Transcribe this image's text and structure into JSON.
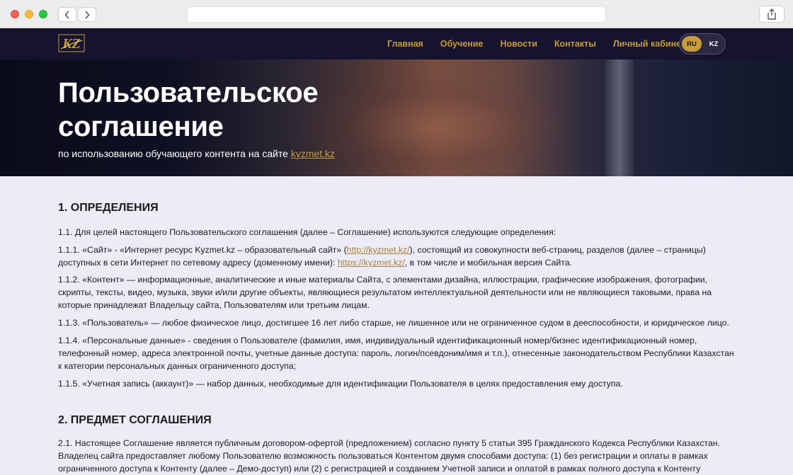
{
  "browser": {
    "back_icon": "chevron-left-icon",
    "forward_icon": "chevron-right-icon",
    "share_icon": "share-icon",
    "address": ""
  },
  "nav": {
    "logo_text": "KZ",
    "items": [
      "Главная",
      "Обучение",
      "Новости",
      "Контакты",
      "Личный кабинет"
    ],
    "lang_active": "RU",
    "lang_other": "KZ"
  },
  "hero": {
    "title": "Пользовательское соглашение",
    "subtitle_prefix": "по использованию обучающего контента на сайте ",
    "subtitle_link": "kyzmet.kz"
  },
  "sections": [
    {
      "heading": "1. ОПРЕДЕЛЕНИЯ",
      "p1": "1.1. Для целей настоящего Пользовательского соглашения (далее – Соглашение) используются следующие определения:",
      "p2_a": "1.1.1. «Сайт» - «Интернет ресурс Kyzmet.kz – образовательный сайт» (",
      "p2_link1": "http://kyzmet.kz/",
      "p2_b": "), состоящий из совокупности веб-страниц, разделов (далее – страницы) доступных в сети Интернет по сетевому адресу (доменному имени): ",
      "p2_link2": "https://kyzmet.kz/",
      "p2_c": ", в том числе и мобильная версия Сайта.",
      "p3": "1.1.2. «Контент» — информационные, аналитические и иные материалы Сайта, с элементами дизайна, иллюстрации, графические изображения, фотографии, скрипты, тексты, видео, музыка, звуки и/или другие объекты, являющиеся результатом интеллектуальной деятельности или не являющиеся таковыми, права на которые принадлежат Владельцу сайта, Пользователям или третьим лицам.",
      "p4": "1.1.3. «Пользователь» — любое физическое лицо, достигшее 16 лет либо старше, не лишенное или не ограниченное судом в дееспособности, и юридическое лицо.",
      "p5": "1.1.4. «Персональные данные» - сведения о Пользователе (фамилия, имя, индивидуальный идентификационный номер/бизнес идентификационный номер, телефонный номер, адреса электронной почты, учетные данные доступа: пароль, логин/псевдоним/имя и т.п.), отнесенные законодательством Республики Казахстан к категории персональных данных ограниченного доступа;",
      "p6": "1.1.5. «Учетная запись (аккаунт)» — набор данных, необходимые для идентификации Пользователя в целях предоставления ему доступа."
    },
    {
      "heading": "2. ПРЕДМЕТ СОГЛАШЕНИЯ",
      "p1": "2.1. Настоящее Соглашение является публичным договором-офертой (предложением) согласно пункту 5 статьи 395 Гражданского Кодекса Республики Казахстан. Владелец сайта предоставляет любому Пользователю возможность пользоваться Контентом двумя способами доступа: (1) без регистрации и оплаты в рамках ограниченного доступа к Контенту (далее – Демо-доступ) или (2) с регистрацией и созданием Учетной записи и оплатой в рамках полного доступа к Контенту"
    }
  ],
  "colors": {
    "accent": "#c89b3c",
    "nav_bg": "#15132e",
    "page_bg": "#ecebf8"
  }
}
